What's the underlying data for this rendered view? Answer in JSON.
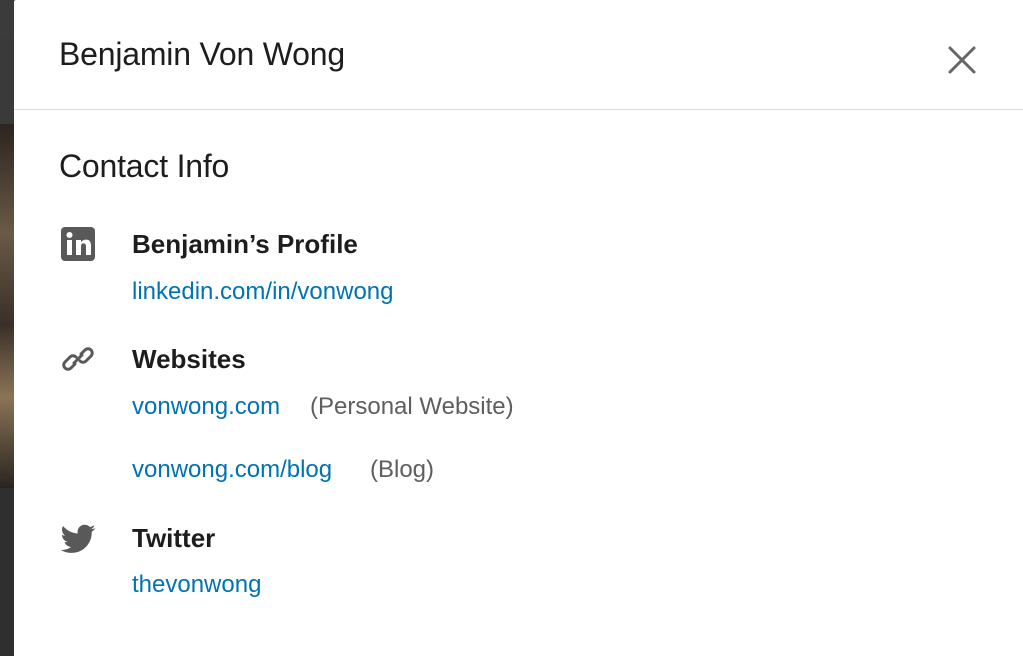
{
  "modal": {
    "title": "Benjamin Von Wong",
    "close_icon": "close-icon"
  },
  "contact": {
    "section_title": "Contact Info",
    "profile": {
      "icon": "linkedin-icon",
      "heading": "Benjamin’s Profile",
      "link": "linkedin.com/in/vonwong"
    },
    "websites": {
      "icon": "link-icon",
      "heading": "Websites",
      "items": [
        {
          "link": "vonwong.com",
          "note": "(Personal Website)"
        },
        {
          "link": "vonwong.com/blog",
          "note": "(Blog)"
        }
      ]
    },
    "twitter": {
      "icon": "twitter-icon",
      "heading": "Twitter",
      "link": "thevonwong"
    }
  },
  "colors": {
    "link": "#0073b1",
    "text": "#1d1d1d",
    "muted": "#5e5e5e",
    "icon": "#595959"
  }
}
